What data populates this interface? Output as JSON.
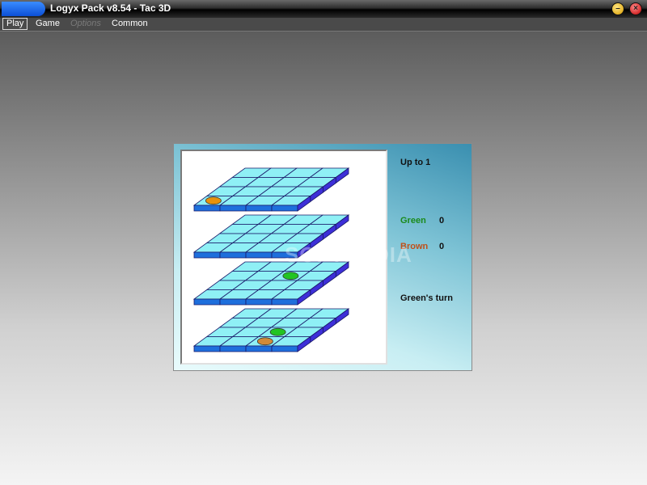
{
  "window": {
    "title": "Logyx Pack v8.54 - Tac 3D"
  },
  "menu": {
    "items": [
      "Play",
      "Game",
      "Options",
      "Common"
    ]
  },
  "game": {
    "target_label": "Up to 1",
    "players": [
      {
        "name": "Green",
        "score": "0",
        "color": "#1a8a1a"
      },
      {
        "name": "Brown",
        "score": "0",
        "color": "#c0501a"
      }
    ],
    "turn_label": "Green's turn",
    "grid_size": 4,
    "levels": 4,
    "pieces": [
      {
        "level": 0,
        "row": 3,
        "col": 0,
        "color": "#e8920c"
      },
      {
        "level": 2,
        "row": 1,
        "col": 2,
        "color": "#22c422"
      },
      {
        "level": 3,
        "row": 2,
        "col": 2,
        "color": "#22c422"
      },
      {
        "level": 3,
        "row": 3,
        "col": 2,
        "color": "#d08a3a"
      }
    ]
  },
  "colors": {
    "tile_top": "#8ff0f5",
    "tile_side": "#1e6fdc",
    "board_side": "#3d2fd8",
    "grid_line": "#1a1a6a"
  },
  "watermark": "SOFTPEDIA"
}
